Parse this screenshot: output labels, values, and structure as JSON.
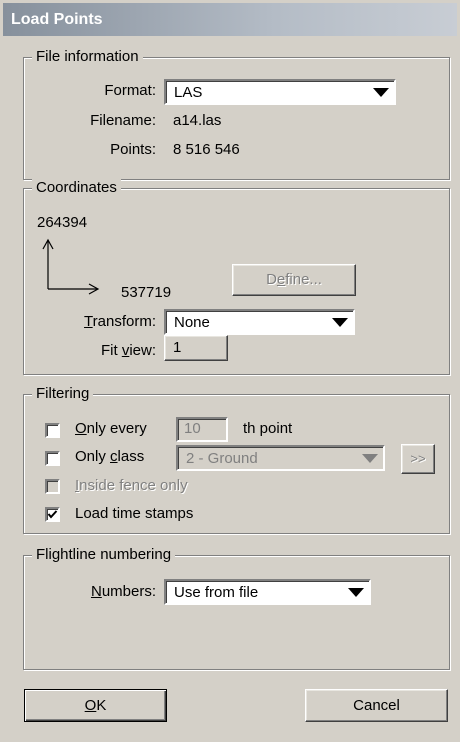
{
  "window": {
    "title": "Load Points"
  },
  "file_info": {
    "legend": "File information",
    "format_label": "Format:",
    "format_value": "LAS",
    "filename_label": "Filename:",
    "filename_value": "a14.las",
    "points_label": "Points:",
    "points_value": "8 516 546"
  },
  "coordinates": {
    "legend": "Coordinates",
    "y_value": "264394",
    "x_value": "537719",
    "define_pre": "D",
    "define_u": "e",
    "define_post": "fine...",
    "transform_u": "T",
    "transform_rest": "ransform:",
    "transform_value": "None",
    "fitview_pre": "Fit ",
    "fitview_u": "v",
    "fitview_post": "iew:",
    "fitview_value": "1"
  },
  "filtering": {
    "legend": "Filtering",
    "only_every_u": "O",
    "only_every_rest": "nly every",
    "only_every_value": "10",
    "only_every_suffix": "th point",
    "only_class_pre": "Only ",
    "only_class_u": "c",
    "only_class_post": "lass",
    "class_value": "2 - Ground",
    "more_label": ">>",
    "inside_fence_u": "I",
    "inside_fence_rest": "nside fence only",
    "load_time_stamps": "Load time stamps",
    "only_every_checked": false,
    "only_class_checked": false,
    "inside_fence_checked": false,
    "load_time_stamps_checked": true
  },
  "flightline": {
    "legend": "Flightline numbering",
    "numbers_u": "N",
    "numbers_rest": "umbers:",
    "numbers_value": "Use from file"
  },
  "buttons": {
    "ok_u": "O",
    "ok_rest": "K",
    "cancel": "Cancel"
  }
}
